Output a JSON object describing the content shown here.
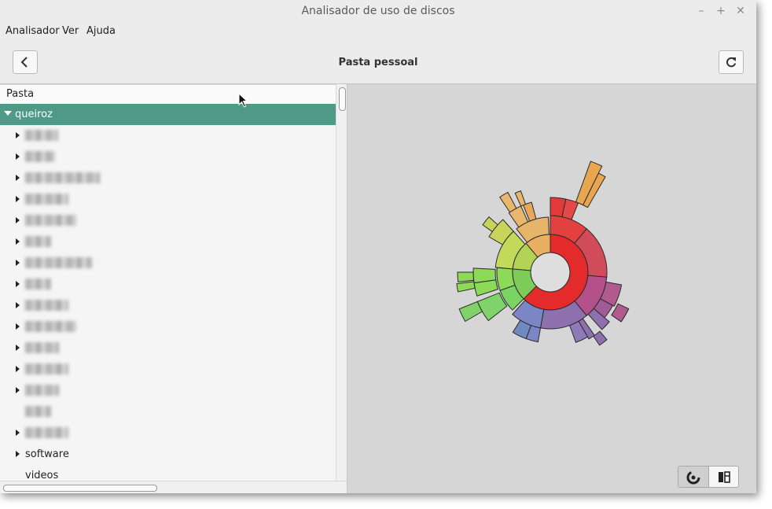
{
  "window": {
    "title": "Analisador de uso de discos",
    "controls": [
      "–",
      "+",
      "✕"
    ]
  },
  "menu": [
    "Analisador",
    "Ver",
    "Ajuda"
  ],
  "toolbar": {
    "title": "Pasta pessoal",
    "back_icon": "chevron-left-icon",
    "refresh_icon": "refresh-icon"
  },
  "tree": {
    "column": "Pasta",
    "root": "queiroz",
    "items": [
      {
        "label": "",
        "expandable": true
      },
      {
        "label": "",
        "expandable": true
      },
      {
        "label": "",
        "expandable": true
      },
      {
        "label": "",
        "expandable": true
      },
      {
        "label": "",
        "expandable": true
      },
      {
        "label": "",
        "expandable": true
      },
      {
        "label": "",
        "expandable": true
      },
      {
        "label": "",
        "expandable": true
      },
      {
        "label": "",
        "expandable": true
      },
      {
        "label": "",
        "expandable": true
      },
      {
        "label": "",
        "expandable": true
      },
      {
        "label": "",
        "expandable": true
      },
      {
        "label": "",
        "expandable": true
      },
      {
        "label": "",
        "expandable": false
      },
      {
        "label": "",
        "expandable": true
      },
      {
        "label": "software",
        "expandable": true
      },
      {
        "label": "videos",
        "expandable": false
      }
    ]
  },
  "view_switcher": {
    "active": "rings-chart-icon",
    "options": [
      "rings-chart-icon",
      "treemap-icon"
    ]
  },
  "colors": {
    "selection": "#4f9a87",
    "background": "#d6d6d6"
  }
}
